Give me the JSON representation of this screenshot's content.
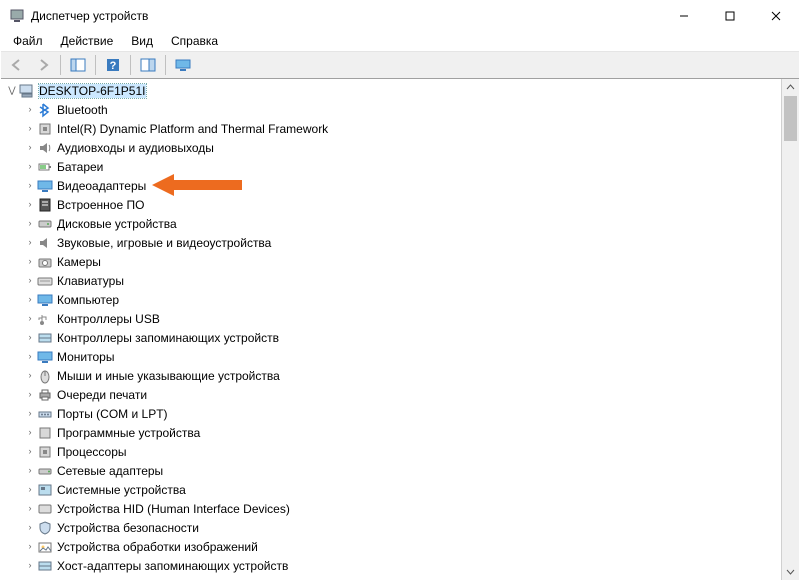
{
  "window": {
    "title": "Диспетчер устройств"
  },
  "menu": {
    "file": "Файл",
    "action": "Действие",
    "view": "Вид",
    "help": "Справка"
  },
  "root": {
    "label": "DESKTOP-6F1P51I"
  },
  "nodes": [
    {
      "label": "Bluetooth",
      "icon": "bt"
    },
    {
      "label": "Intel(R) Dynamic Platform and Thermal Framework",
      "icon": "proc"
    },
    {
      "label": "Аудиовходы и аудиовыходы",
      "icon": "audio"
    },
    {
      "label": "Батареи",
      "icon": "battery"
    },
    {
      "label": "Видеоадаптеры",
      "icon": "display"
    },
    {
      "label": "Встроенное ПО",
      "icon": "fw"
    },
    {
      "label": "Дисковые устройства",
      "icon": "disk"
    },
    {
      "label": "Звуковые, игровые и видеоустройства",
      "icon": "sound"
    },
    {
      "label": "Камеры",
      "icon": "camera"
    },
    {
      "label": "Клавиатуры",
      "icon": "kb"
    },
    {
      "label": "Компьютер",
      "icon": "pc"
    },
    {
      "label": "Контроллеры USB",
      "icon": "usb"
    },
    {
      "label": "Контроллеры запоминающих устройств",
      "icon": "storage"
    },
    {
      "label": "Мониторы",
      "icon": "display"
    },
    {
      "label": "Мыши и иные указывающие устройства",
      "icon": "mouse"
    },
    {
      "label": "Очереди печати",
      "icon": "print"
    },
    {
      "label": "Порты (COM и LPT)",
      "icon": "port"
    },
    {
      "label": "Программные устройства",
      "icon": "sw"
    },
    {
      "label": "Процессоры",
      "icon": "proc"
    },
    {
      "label": "Сетевые адаптеры",
      "icon": "net"
    },
    {
      "label": "Системные устройства",
      "icon": "sys"
    },
    {
      "label": "Устройства HID (Human Interface Devices)",
      "icon": "hid"
    },
    {
      "label": "Устройства безопасности",
      "icon": "sec"
    },
    {
      "label": "Устройства обработки изображений",
      "icon": "img"
    },
    {
      "label": "Хост-адаптеры запоминающих устройств",
      "icon": "storage"
    }
  ],
  "annotation": {
    "highlight_index": 4,
    "arrow_color": "#ed6b1f"
  }
}
